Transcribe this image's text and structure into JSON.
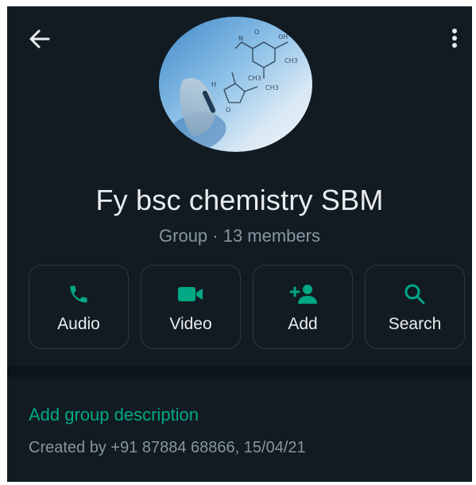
{
  "group": {
    "name": "Fy bsc chemistry SBM",
    "subtitle": "Group · 13 members"
  },
  "actions": [
    {
      "label": "Audio",
      "icon": "phone-icon"
    },
    {
      "label": "Video",
      "icon": "video-camera-icon"
    },
    {
      "label": "Add",
      "icon": "add-person-icon"
    },
    {
      "label": "Search",
      "icon": "search-icon"
    }
  ],
  "description": {
    "add_label": "Add group description",
    "created_by": "Created by +91 87884 68866, 15/04/21"
  },
  "colors": {
    "background": "#121b22",
    "accent": "#00a884",
    "primary_text": "#e9edef",
    "secondary_text": "#8696a0"
  }
}
